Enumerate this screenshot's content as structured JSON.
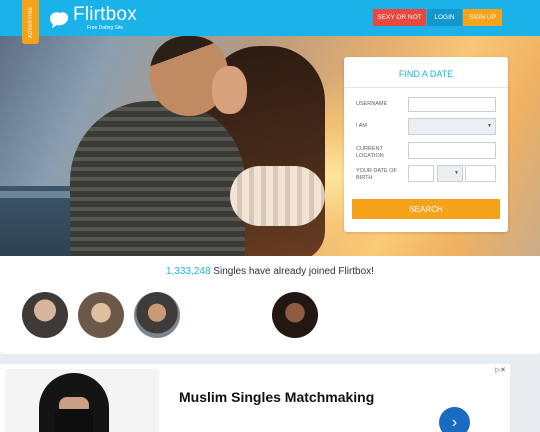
{
  "header": {
    "side_tag": "ADVERTISE",
    "logo_name": "Flirtbox",
    "logo_tagline": "Free Dating Site",
    "nav": {
      "sexy_or_not": "SEXY OR NOT",
      "login": "LOGIN",
      "signup": "SIGN UP"
    },
    "colors": {
      "header": "#1ab2e8",
      "red": "#e8483f",
      "blue": "#1596cc",
      "orange": "#f7a21b"
    }
  },
  "find_date": {
    "title": "FIND A DATE",
    "labels": {
      "username": "USERNAME",
      "i_am": "I AM",
      "current_location": "CURRENT LOCATION",
      "date_of_birth": "YOUR DATE OF BIRTH"
    },
    "search_label": "SEARCH"
  },
  "singles": {
    "count": "1,333,248",
    "text": " Singles have already joined Flirtbox!"
  },
  "ad": {
    "title": "Muslim Singles Matchmaking",
    "arrow_icon": "chevron-right-icon"
  }
}
